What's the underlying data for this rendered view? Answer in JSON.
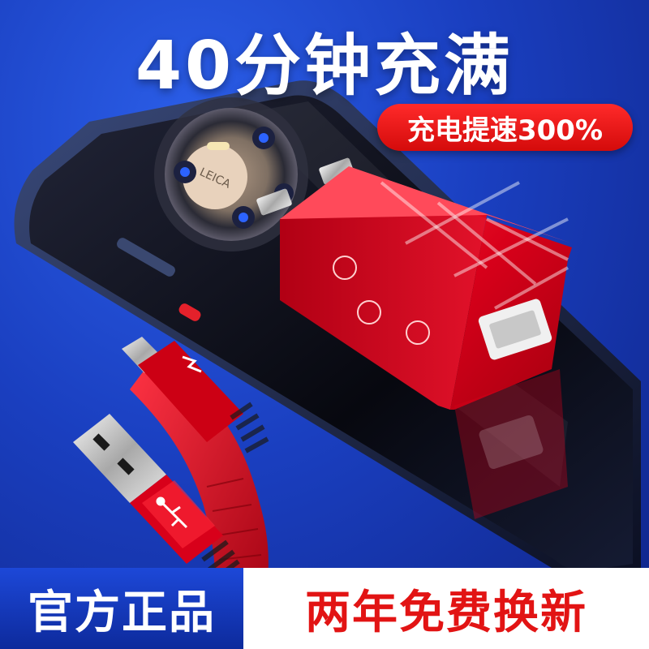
{
  "headline": "40分钟充满",
  "badge": {
    "text": "充电提速300%"
  },
  "footer": {
    "left_text": "官方正品",
    "right_text": "两年免费换新"
  },
  "phone_camera": {
    "brand_text": "LEICA"
  },
  "colors": {
    "background": "#1a3fc0",
    "accent_red": "#e21414",
    "footer_left": "#1d48d8",
    "footer_right": "#ffffff"
  },
  "icons": [
    "lightning-icon",
    "usb-symbol-icon"
  ]
}
